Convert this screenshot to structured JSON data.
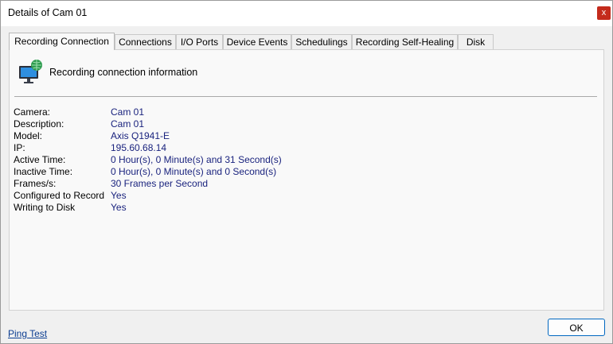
{
  "window": {
    "title": "Details of Cam 01",
    "close_label": "x"
  },
  "tabs": [
    {
      "label": "Recording Connection",
      "active": true
    },
    {
      "label": "Connections",
      "active": false
    },
    {
      "label": "I/O Ports",
      "active": false
    },
    {
      "label": "Device Events",
      "active": false
    },
    {
      "label": "Schedulings",
      "active": false
    },
    {
      "label": "Recording Self-Healing",
      "active": false
    },
    {
      "label": "Disk",
      "active": false
    }
  ],
  "header": {
    "icon": "network-monitor-icon",
    "text": "Recording connection information"
  },
  "details": [
    {
      "label": "Camera:",
      "value": "Cam 01"
    },
    {
      "label": "Description:",
      "value": "Cam 01"
    },
    {
      "label": "Model:",
      "value": "Axis Q1941-E"
    },
    {
      "label": "IP:",
      "value": "195.60.68.14"
    },
    {
      "label": "Active Time:",
      "value": "0 Hour(s), 0 Minute(s) and 31 Second(s)"
    },
    {
      "label": "Inactive Time:",
      "value": "0 Hour(s), 0 Minute(s) and 0 Second(s)"
    },
    {
      "label": "Frames/s:",
      "value": "30 Frames per Second"
    },
    {
      "label": "Configured to Record",
      "value": "Yes"
    },
    {
      "label": "Writing to Disk",
      "value": "Yes"
    }
  ],
  "footer": {
    "ping_link": "Ping Test",
    "ok_label": "OK"
  },
  "colors": {
    "value_text": "#1a237e",
    "close_button": "#c42b1c",
    "ok_border": "#0067c0"
  }
}
